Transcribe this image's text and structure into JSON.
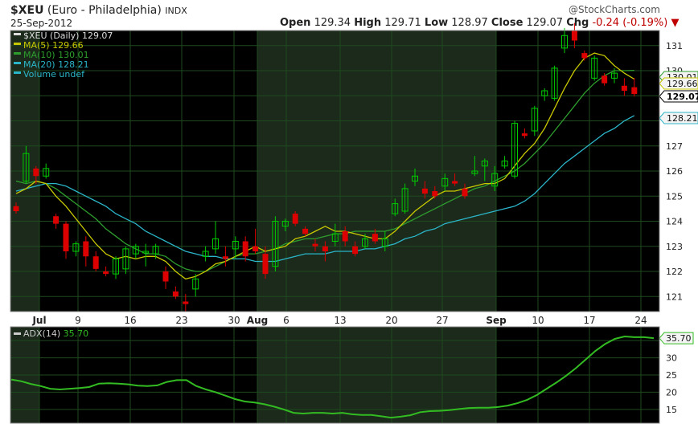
{
  "header": {
    "symbol": "$XEU",
    "description": "(Euro - Philadelphia)",
    "exchange": "INDX",
    "date": "25-Sep-2012",
    "watermark": "@StockCharts.com",
    "open_label": "Open",
    "open": "129.34",
    "high_label": "High",
    "high": "129.71",
    "low_label": "Low",
    "low": "128.97",
    "close_label": "Close",
    "close": "129.07",
    "chg_label": "Chg",
    "chg": "-0.24 (-0.19%)"
  },
  "colors": {
    "up": "#00cc00",
    "down": "#dd0000",
    "ma5": "#c8c800",
    "ma10": "#2e9e2e",
    "ma20": "#2bb5c8",
    "adx": "#33bb22",
    "grid": "#1f4a1f",
    "bg": "#000000",
    "shade": "#1b2a1b"
  },
  "chart_data": [
    {
      "type": "candlestick",
      "title": "$XEU (Daily) 129.07",
      "legend": [
        {
          "label": "$XEU (Daily) 129.07",
          "color": "#dddddd"
        },
        {
          "label": "MA(5) 129.66",
          "color": "#c8c800"
        },
        {
          "label": "MA(10) 130.01",
          "color": "#2e9e2e"
        },
        {
          "label": "MA(20) 128.21",
          "color": "#2bb5c8"
        },
        {
          "label": "Volume undef",
          "color": "#2bb5c8"
        }
      ],
      "x_ticks": [
        "Jul",
        "9",
        "16",
        "23",
        "30",
        "Aug",
        "6",
        "13",
        "20",
        "27",
        "Sep",
        "10",
        "17",
        "24"
      ],
      "y_ticks": [
        "121",
        "122",
        "123",
        "124",
        "125",
        "126",
        "127",
        "128",
        "129",
        "130",
        "131"
      ],
      "ylim": [
        120.4,
        131.6
      ],
      "value_tags": [
        {
          "label": "130.01",
          "value": 130.01,
          "style": "ma10"
        },
        {
          "label": "129.66",
          "value": 129.66,
          "style": "ma5"
        },
        {
          "label": "129.07",
          "value": 129.07,
          "style": "close"
        },
        {
          "label": "128.21",
          "value": 128.21,
          "style": "ma20"
        }
      ],
      "candles": [
        [
          124.6,
          124.75,
          124.3,
          124.4
        ],
        [
          125.6,
          127.0,
          125.5,
          126.7
        ],
        [
          126.1,
          126.2,
          125.5,
          125.8
        ],
        [
          125.8,
          126.3,
          125.7,
          126.1
        ],
        [
          124.2,
          124.3,
          123.7,
          123.9
        ],
        [
          123.9,
          124.0,
          122.5,
          122.8
        ],
        [
          122.8,
          123.2,
          122.6,
          123.1
        ],
        [
          123.2,
          123.4,
          122.2,
          122.6
        ],
        [
          122.6,
          122.8,
          122.0,
          122.1
        ],
        [
          122.0,
          122.2,
          121.8,
          121.9
        ],
        [
          121.9,
          122.6,
          121.7,
          122.5
        ],
        [
          122.1,
          123.0,
          121.9,
          122.9
        ],
        [
          122.7,
          123.1,
          122.5,
          123.0
        ],
        [
          122.8,
          123.1,
          122.2,
          122.8
        ],
        [
          122.7,
          123.1,
          122.5,
          123.0
        ],
        [
          122.0,
          122.2,
          121.3,
          121.6
        ],
        [
          121.2,
          121.4,
          120.9,
          121.0
        ],
        [
          120.8,
          121.1,
          120.4,
          120.7
        ],
        [
          121.3,
          121.9,
          121.0,
          121.7
        ],
        [
          122.6,
          123.0,
          122.4,
          122.8
        ],
        [
          122.9,
          124.0,
          122.7,
          123.3
        ],
        [
          122.6,
          123.0,
          122.2,
          122.5
        ],
        [
          122.9,
          123.4,
          122.5,
          123.2
        ],
        [
          123.2,
          123.4,
          122.4,
          122.6
        ],
        [
          123.0,
          123.7,
          122.7,
          122.8
        ],
        [
          122.7,
          123.0,
          121.7,
          121.9
        ],
        [
          122.2,
          124.2,
          122.0,
          124.0
        ],
        [
          123.8,
          124.1,
          123.6,
          124.0
        ],
        [
          124.3,
          124.4,
          123.8,
          123.9
        ],
        [
          123.7,
          123.8,
          123.4,
          123.5
        ],
        [
          123.1,
          123.3,
          122.8,
          123.0
        ],
        [
          123.0,
          123.2,
          122.4,
          122.8
        ],
        [
          123.2,
          123.9,
          123.0,
          123.5
        ],
        [
          123.6,
          123.8,
          123.0,
          123.2
        ],
        [
          123.0,
          123.2,
          122.6,
          122.7
        ],
        [
          123.0,
          123.5,
          122.9,
          123.3
        ],
        [
          123.5,
          123.7,
          123.1,
          123.2
        ],
        [
          123.0,
          123.6,
          122.8,
          123.3
        ],
        [
          124.3,
          124.9,
          124.2,
          124.7
        ],
        [
          124.4,
          125.5,
          124.3,
          125.3
        ],
        [
          125.6,
          126.1,
          125.4,
          125.8
        ],
        [
          125.3,
          125.6,
          124.9,
          125.1
        ],
        [
          125.2,
          125.4,
          124.9,
          125.0
        ],
        [
          125.4,
          125.9,
          125.2,
          125.7
        ],
        [
          125.6,
          125.9,
          125.4,
          125.5
        ],
        [
          125.3,
          125.5,
          124.9,
          125.0
        ],
        [
          125.9,
          126.6,
          125.8,
          126.0
        ],
        [
          126.2,
          126.5,
          125.6,
          126.4
        ],
        [
          125.4,
          126.2,
          125.2,
          125.9
        ],
        [
          126.2,
          126.6,
          126.1,
          126.4
        ],
        [
          125.8,
          128.0,
          125.7,
          127.9
        ],
        [
          127.5,
          127.7,
          127.3,
          127.4
        ],
        [
          127.6,
          128.6,
          127.4,
          128.5
        ],
        [
          129.0,
          129.3,
          128.8,
          129.2
        ],
        [
          128.9,
          130.2,
          128.8,
          130.1
        ],
        [
          130.9,
          131.7,
          130.7,
          131.4
        ],
        [
          131.6,
          131.9,
          130.9,
          131.2
        ],
        [
          130.7,
          130.8,
          130.4,
          130.5
        ],
        [
          129.7,
          130.6,
          129.6,
          130.5
        ],
        [
          129.8,
          129.9,
          129.4,
          129.5
        ],
        [
          129.7,
          130.1,
          129.5,
          129.9
        ],
        [
          129.4,
          129.7,
          129.0,
          129.2
        ],
        [
          129.34,
          129.71,
          128.97,
          129.07
        ]
      ],
      "ma5": [
        125.1,
        125.3,
        125.6,
        125.5,
        125.0,
        124.6,
        124.1,
        123.6,
        123.1,
        122.7,
        122.5,
        122.6,
        122.5,
        122.6,
        122.6,
        122.4,
        122.0,
        121.7,
        121.8,
        122.0,
        122.3,
        122.4,
        122.6,
        122.8,
        123.0,
        122.8,
        122.9,
        123.0,
        123.3,
        123.4,
        123.6,
        123.8,
        123.6,
        123.6,
        123.5,
        123.4,
        123.3,
        123.3,
        123.6,
        124.0,
        124.4,
        124.7,
        125.0,
        125.2,
        125.2,
        125.3,
        125.4,
        125.5,
        125.5,
        125.7,
        126.2,
        126.7,
        127.1,
        127.7,
        128.5,
        129.3,
        130.0,
        130.5,
        130.7,
        130.6,
        130.2,
        129.9,
        129.66
      ],
      "ma10": [
        125.6,
        125.5,
        125.6,
        125.5,
        125.3,
        125.0,
        124.7,
        124.4,
        124.1,
        123.7,
        123.4,
        123.1,
        122.9,
        122.7,
        122.7,
        122.6,
        122.3,
        122.1,
        122.0,
        122.0,
        122.2,
        122.4,
        122.6,
        122.7,
        122.7,
        122.8,
        122.9,
        123.1,
        123.2,
        123.3,
        123.3,
        123.4,
        123.5,
        123.5,
        123.6,
        123.6,
        123.6,
        123.6,
        123.7,
        123.9,
        124.1,
        124.3,
        124.5,
        124.7,
        124.9,
        125.1,
        125.3,
        125.4,
        125.6,
        125.8,
        126.0,
        126.3,
        126.7,
        127.1,
        127.6,
        128.1,
        128.6,
        129.1,
        129.5,
        129.8,
        130.0,
        130.0,
        130.01
      ],
      "ma20": [
        125.2,
        125.3,
        125.4,
        125.5,
        125.5,
        125.4,
        125.2,
        125.0,
        124.8,
        124.6,
        124.3,
        124.1,
        123.9,
        123.6,
        123.4,
        123.2,
        123.0,
        122.8,
        122.7,
        122.6,
        122.6,
        122.5,
        122.5,
        122.5,
        122.4,
        122.4,
        122.4,
        122.5,
        122.6,
        122.7,
        122.7,
        122.7,
        122.8,
        122.8,
        122.8,
        122.9,
        122.9,
        123.0,
        123.1,
        123.3,
        123.4,
        123.6,
        123.7,
        123.9,
        124.0,
        124.1,
        124.2,
        124.3,
        124.4,
        124.5,
        124.6,
        124.8,
        125.1,
        125.5,
        125.9,
        126.3,
        126.6,
        126.9,
        127.2,
        127.5,
        127.7,
        128.0,
        128.21
      ]
    },
    {
      "type": "line",
      "title": "ADX(14) 35.70",
      "y_ticks": [
        "15",
        "20",
        "25",
        "30",
        "35"
      ],
      "ylim": [
        11,
        39
      ],
      "value_tag": {
        "label": "35.70",
        "value": 35.7
      },
      "values": [
        23.7,
        23.2,
        22.4,
        21.8,
        21.0,
        20.8,
        21.0,
        21.2,
        21.5,
        22.5,
        22.6,
        22.5,
        22.3,
        21.9,
        21.8,
        22.0,
        23.0,
        23.5,
        23.5,
        21.8,
        20.8,
        20.0,
        19.0,
        18.0,
        17.3,
        17.0,
        16.5,
        15.8,
        15.0,
        14.0,
        13.8,
        14.0,
        14.0,
        13.8,
        14.0,
        13.6,
        13.4,
        13.4,
        13.0,
        12.6,
        12.9,
        13.3,
        14.2,
        14.5,
        14.6,
        14.8,
        15.1,
        15.4,
        15.5,
        15.5,
        15.7,
        16.1,
        16.8,
        17.8,
        19.2,
        21.0,
        22.8,
        24.8,
        27.0,
        29.5,
        32.0,
        34.0,
        35.5,
        36.2,
        36.0,
        36.0,
        35.7
      ]
    }
  ]
}
